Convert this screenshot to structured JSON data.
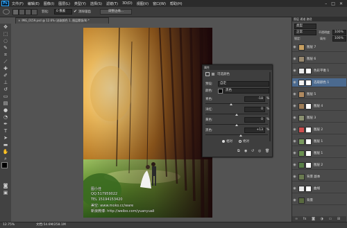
{
  "app": {
    "logo": "Ps"
  },
  "menubar": {
    "items": [
      "文件(F)",
      "编辑(E)",
      "图像(I)",
      "图层(L)",
      "类型(Y)",
      "选择(S)",
      "滤镜(T)",
      "3D(D)",
      "视图(V)",
      "窗口(W)",
      "帮助(H)"
    ]
  },
  "options": {
    "feather_label": "羽化:",
    "feather_value": "0 像素",
    "antialias_label": "消除锯齿",
    "refine_edge_label": "调整边缘..."
  },
  "document": {
    "tab_title": "IMG_0159.psd @ 12.6% (选取颜色 1, 图层蒙版/8) *"
  },
  "canvas": {
    "watermark_lines": [
      "图小佳",
      "QQ:517959022",
      "TEL 15194153420",
      "美空: www.moko.cc/ware",
      "新浪微博: http://weibo.com/yuanyuali"
    ]
  },
  "status": {
    "zoom": "12.75%",
    "doc_size": "文档:54.6M/258.1M"
  },
  "properties": {
    "title": "属性",
    "panel_name": "可选颜色",
    "preset_label": "预设:",
    "preset_value": "自定",
    "colors_label": "颜色:",
    "colors_value": "黑色",
    "sliders": [
      {
        "label": "青色:",
        "value": "-18",
        "fill": 0.41
      },
      {
        "label": "洋红:",
        "value": "0",
        "fill": 0.5
      },
      {
        "label": "黄色:",
        "value": "0",
        "fill": 0.5
      },
      {
        "label": "黑色:",
        "value": "+13",
        "fill": 0.565
      }
    ],
    "percent": "%",
    "method_relative": "相对",
    "method_absolute": "绝对"
  },
  "right_panel": {
    "tabs": [
      "图层",
      "通道",
      "路径"
    ],
    "kind_label": "类型",
    "blend_mode": "正常",
    "opacity_label": "不透明度:",
    "opacity_value": "100%",
    "lock_label": "锁定:",
    "fill_label": "填充:",
    "fill_value": "100%"
  },
  "layers": [
    {
      "name": "图层 7",
      "thumb": "#c8a060",
      "mask": false
    },
    {
      "name": "图层 6",
      "thumb": "#9a8a70",
      "mask": false
    },
    {
      "name": "色彩平衡 1",
      "thumb": "#e8e8e8",
      "mask": true
    },
    {
      "name": "选取颜色 1",
      "thumb": "#f0f0f0",
      "mask": true
    },
    {
      "name": "图层 5",
      "thumb": "#b08a60",
      "mask": false
    },
    {
      "name": "图层 4",
      "thumb": "#a07e58",
      "mask": true
    },
    {
      "name": "图层 3",
      "thumb": "#8a9070",
      "mask": false
    },
    {
      "name": "图层 2",
      "thumb": "#d05050",
      "mask": true
    },
    {
      "name": "图层 1",
      "thumb": "#7a9a60",
      "mask": true
    },
    {
      "name": "图层 1",
      "thumb": "#6a9050",
      "mask": true
    },
    {
      "name": "图层 2",
      "thumb": "#5a8048",
      "mask": true
    },
    {
      "name": "背景 副本",
      "thumb": "#6a7a50",
      "mask": false
    },
    {
      "name": "曲线",
      "thumb": "#e8e8e8",
      "mask": true
    },
    {
      "name": "背景",
      "thumb": "#5a6a40",
      "mask": false
    }
  ],
  "colors": {
    "accent": "#31a8ff",
    "panel_bg": "#3e3e3e",
    "selected_layer": "#4b6a8f"
  }
}
